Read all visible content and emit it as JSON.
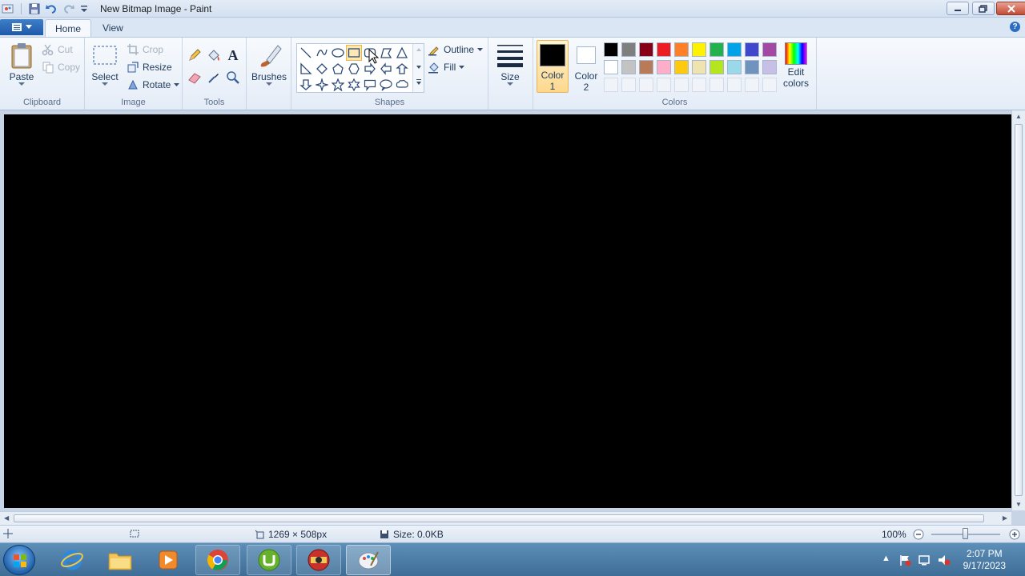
{
  "window": {
    "title": "New Bitmap Image - Paint"
  },
  "tabs": {
    "home": "Home",
    "view": "View"
  },
  "clipboard": {
    "paste": "Paste",
    "cut": "Cut",
    "copy": "Copy",
    "label": "Clipboard"
  },
  "image": {
    "select": "Select",
    "crop": "Crop",
    "resize": "Resize",
    "rotate": "Rotate",
    "label": "Image"
  },
  "tools": {
    "label": "Tools",
    "text_glyph": "A"
  },
  "brushes": {
    "label": "Brushes"
  },
  "shapes": {
    "label": "Shapes",
    "outline": "Outline",
    "fill": "Fill"
  },
  "size": {
    "label": "Size"
  },
  "colors": {
    "label": "Colors",
    "color1_line1": "Color",
    "color1_line2": "1",
    "color2_line1": "Color",
    "color2_line2": "2",
    "edit_line1": "Edit",
    "edit_line2": "colors",
    "color1_value": "#000000",
    "color2_value": "#ffffff",
    "row1": [
      "#000000",
      "#7f7f7f",
      "#880015",
      "#ed1c24",
      "#ff7f27",
      "#fff200",
      "#22b14c",
      "#00a2e8",
      "#3f48cc",
      "#a349a4"
    ],
    "row2": [
      "#ffffff",
      "#c3c3c3",
      "#b97a57",
      "#ffaec9",
      "#ffc90e",
      "#efe4b0",
      "#b5e61d",
      "#99d9ea",
      "#7092be",
      "#c8bfe7"
    ]
  },
  "status": {
    "dimensions": "1269 × 508px",
    "size": "Size: 0.0KB",
    "zoom": "100%",
    "zoom_level": 1.0
  },
  "taskbar": {
    "time": "2:07 PM",
    "date": "9/17/2023"
  }
}
